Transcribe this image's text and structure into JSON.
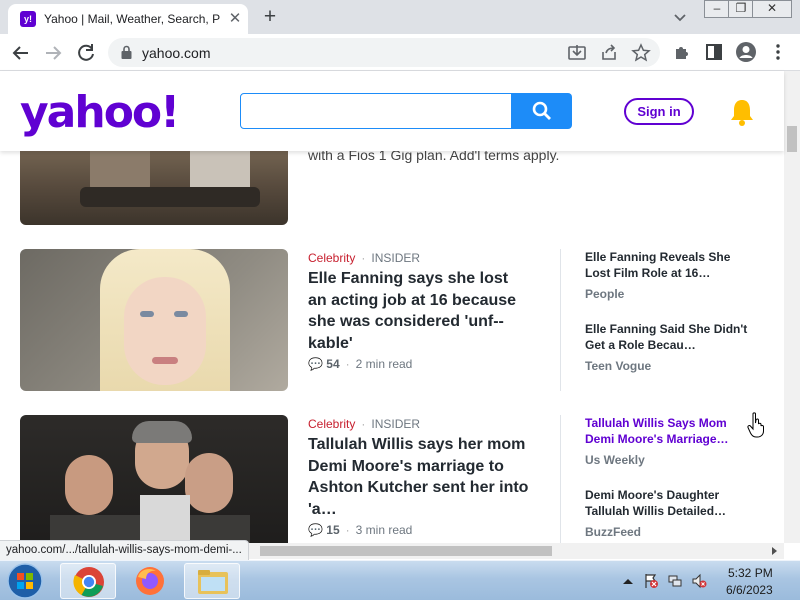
{
  "browser": {
    "tab_title": "Yahoo | Mail, Weather, Search, Politics, News, Finance, Sports & Videos",
    "favicon_text": "y!",
    "url": "yahoo.com",
    "status_url": "yahoo.com/.../tallulah-willis-says-mom-demi-..."
  },
  "header": {
    "logo": "yahoo!",
    "search_value": "",
    "sign_in": "Sign in",
    "accent_color": "#6001d2",
    "search_color": "#1d8cf8"
  },
  "top_teaser": "with a Fios 1 Gig plan. Add'l terms apply.",
  "stories": [
    {
      "category": "Celebrity",
      "source": "INSIDER",
      "headline": "Elle Fanning says she lost an acting job at 16 because she was considered 'unf--kable'",
      "comments": "54",
      "read_time": "2 min read",
      "related": [
        {
          "title": "Elle Fanning Reveals She Lost Film Role at 16…",
          "source": "People",
          "visited": false
        },
        {
          "title": "Elle Fanning Said She Didn't Get a Role Becau…",
          "source": "Teen Vogue",
          "visited": false
        }
      ]
    },
    {
      "category": "Celebrity",
      "source": "INSIDER",
      "headline": "Tallulah Willis says her mom Demi Moore's marriage to Ashton Kutcher sent her into 'a…",
      "comments": "15",
      "read_time": "3 min read",
      "related": [
        {
          "title": "Tallulah Willis Says Mom Demi Moore's Marriage…",
          "source": "Us Weekly",
          "visited": true
        },
        {
          "title": "Demi Moore's Daughter Tallulah Willis Detailed…",
          "source": "BuzzFeed",
          "visited": false
        }
      ]
    }
  ],
  "taskbar": {
    "time": "5:32 PM",
    "date": "6/6/2023",
    "apps": [
      "chrome-icon",
      "firefox-icon",
      "file-explorer-icon"
    ]
  }
}
